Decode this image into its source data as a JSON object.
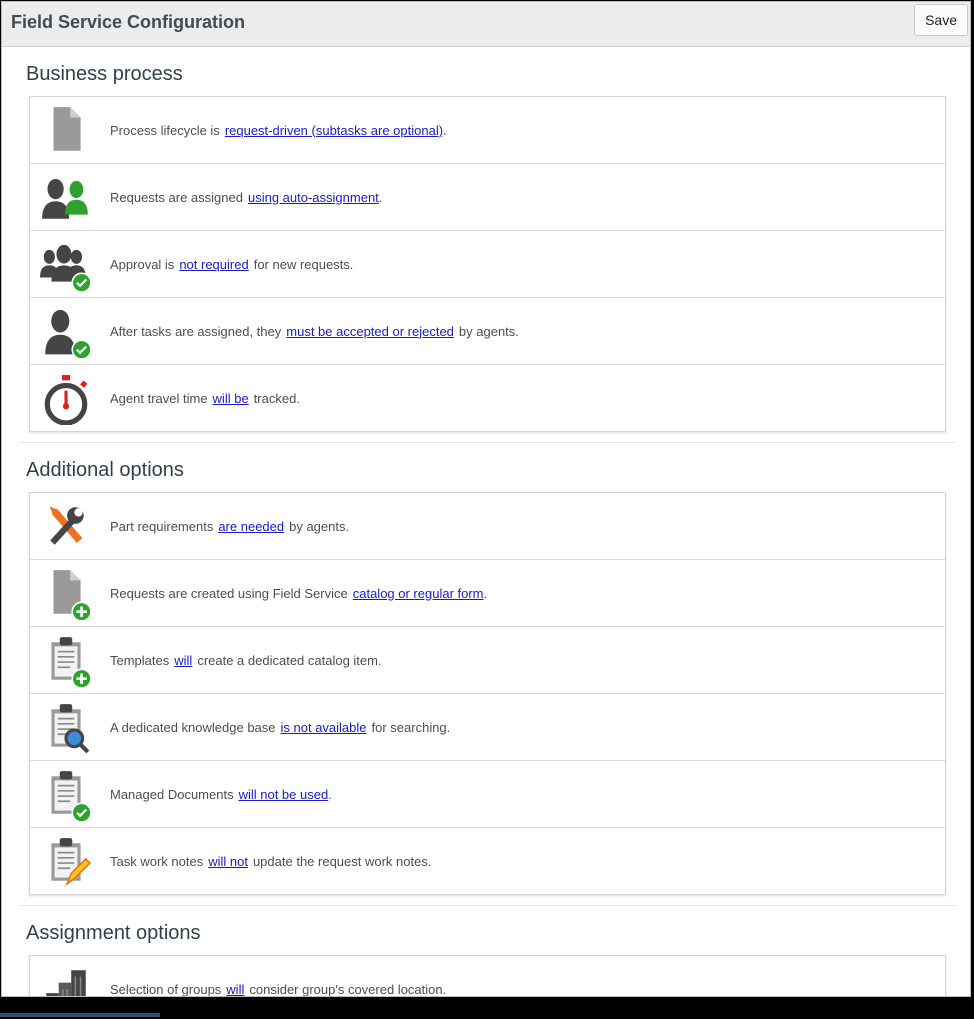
{
  "header": {
    "title": "Field Service Configuration",
    "save_label": "Save"
  },
  "sections": [
    {
      "title": "Business process",
      "rows": [
        {
          "icon": "document-icon",
          "pre": "Process lifecycle is",
          "link": "request-driven (subtasks are optional)",
          "post": "."
        },
        {
          "icon": "users-assign-icon",
          "pre": "Requests are assigned",
          "link": "using auto-assignment",
          "post": "."
        },
        {
          "icon": "group-approved-icon",
          "pre": "Approval is",
          "link": "not required",
          "post": "for new requests."
        },
        {
          "icon": "user-approved-icon",
          "pre": "After tasks are assigned, they",
          "link": "must be accepted or rejected",
          "post": "by agents."
        },
        {
          "icon": "stopwatch-icon",
          "pre": "Agent travel time",
          "link": "will be",
          "post": "tracked."
        }
      ]
    },
    {
      "title": "Additional options",
      "rows": [
        {
          "icon": "tools-icon",
          "pre": "Part requirements",
          "link": "are needed",
          "post": "by agents."
        },
        {
          "icon": "document-add-icon",
          "pre": "Requests are created using Field Service",
          "link": "catalog or regular form",
          "post": "."
        },
        {
          "icon": "clipboard-add-icon",
          "pre": "Templates",
          "link": "will",
          "post": "create a dedicated catalog item."
        },
        {
          "icon": "clipboard-search-icon",
          "pre": "A dedicated knowledge base",
          "link": "is not available",
          "post": "for searching."
        },
        {
          "icon": "clipboard-check-icon",
          "pre": "Managed Documents",
          "link": "will not be used",
          "post": "."
        },
        {
          "icon": "clipboard-edit-icon",
          "pre": "Task work notes",
          "link": "will not",
          "post": "update the request work notes."
        }
      ]
    },
    {
      "title": "Assignment options",
      "rows": [
        {
          "icon": "buildings-icon",
          "pre": "Selection of groups",
          "link": "will",
          "post": "consider group's covered location."
        }
      ]
    }
  ]
}
